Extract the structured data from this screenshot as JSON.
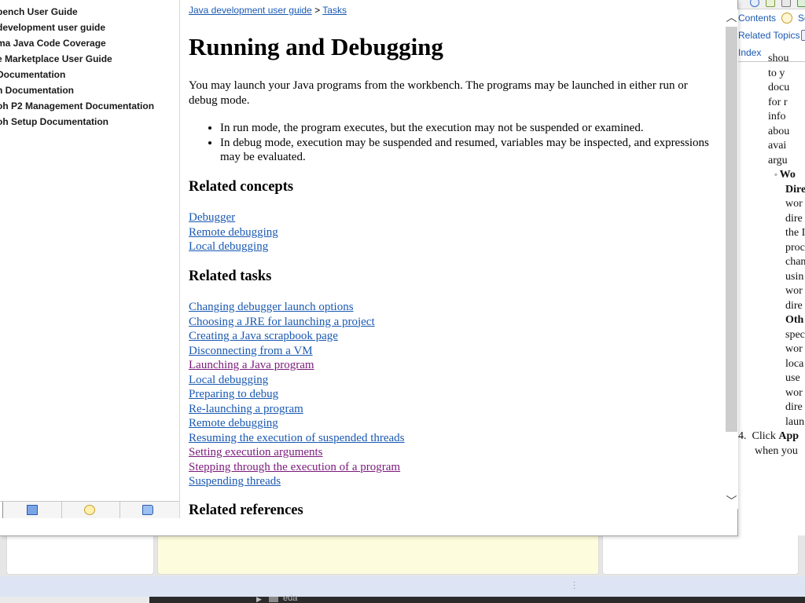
{
  "toc": {
    "items": [
      "bench User Guide",
      "development user guide",
      "ma Java Code Coverage",
      "e Marketplace User Guide",
      "Documentation",
      "n Documentation",
      "oh P2 Management Documentation",
      "oh Setup Documentation"
    ],
    "tab_icons": [
      "contents-tab",
      "bookmarks-icon",
      "search-icon",
      "book-icon"
    ]
  },
  "content": {
    "breadcrumb": {
      "parent": "Java development user guide",
      "separator": ">",
      "current": "Tasks"
    },
    "title": "Running and Debugging",
    "intro": "You may launch your Java programs from the workbench.  The programs may be launched in either run or debug mode.",
    "modes": [
      "In run mode, the program executes, but the execution may not be suspended or examined.",
      "In debug mode, execution may be suspended and resumed, variables may be inspected, and expressions may be evaluated."
    ],
    "related_concepts": {
      "heading": "Related concepts",
      "links": [
        "Debugger",
        "Remote debugging",
        "Local debugging"
      ]
    },
    "related_tasks": {
      "heading": "Related tasks",
      "links": [
        {
          "label": "Changing debugger launch options",
          "visited": false
        },
        {
          "label": "Choosing a JRE for launching a project",
          "visited": false
        },
        {
          "label": "Creating a Java scrapbook page",
          "visited": false
        },
        {
          "label": "Disconnecting from a VM",
          "visited": false
        },
        {
          "label": "Launching a Java program",
          "visited": true
        },
        {
          "label": "Local debugging",
          "visited": false
        },
        {
          "label": "Preparing to debug",
          "visited": false
        },
        {
          "label": "Re-launching a program",
          "visited": false
        },
        {
          "label": "Remote debugging",
          "visited": false
        },
        {
          "label": "Resuming the execution of suspended threads",
          "visited": false
        },
        {
          "label": "Setting execution arguments",
          "visited": true
        },
        {
          "label": "Stepping through the execution of a program",
          "visited": true
        },
        {
          "label": "Suspending threads",
          "visited": false
        }
      ]
    },
    "related_references": {
      "heading": "Related references"
    }
  },
  "background_window": {
    "tabs": {
      "contents": "Contents",
      "search": "Se",
      "related": "Related Topics",
      "index": "Index"
    },
    "text_lines": [
      {
        "text": "shou",
        "bold": false
      },
      {
        "text": "to y",
        "bold": false
      },
      {
        "text": "docu",
        "bold": false
      },
      {
        "text": "for r",
        "bold": false
      },
      {
        "text": "info",
        "bold": false
      },
      {
        "text": "abou",
        "bold": false
      },
      {
        "text": "avai",
        "bold": false
      },
      {
        "text": "argu",
        "bold": false
      },
      {
        "text": "Wo",
        "bold": true,
        "bullet": "◦"
      },
      {
        "text": "Dire",
        "bold": true
      },
      {
        "text": "wor",
        "bold": false
      },
      {
        "text": "dire",
        "bold": false
      },
      {
        "text": "the I",
        "bold": false
      },
      {
        "text": "proc",
        "bold": false
      },
      {
        "text": "chan",
        "bold": false
      },
      {
        "text": "usin",
        "bold": false
      },
      {
        "text": "wor",
        "bold": false
      },
      {
        "text": "dire",
        "bold": false
      },
      {
        "text": "Oth",
        "bold": true
      },
      {
        "text": "spec",
        "bold": false
      },
      {
        "text": "wor",
        "bold": false
      },
      {
        "text": "loca",
        "bold": false
      },
      {
        "text": "use",
        "bold": false
      },
      {
        "text": "wor",
        "bold": false
      },
      {
        "text": "dire",
        "bold": false
      },
      {
        "text": "laun",
        "bold": false
      }
    ],
    "step4_prefix": "4.  Click ",
    "step4_bold": "App",
    "step4_line2": "when you"
  },
  "taskbar": {
    "label": "eda"
  },
  "colors": {
    "link": "#1a59b2",
    "visited_link": "#7a1a7a",
    "status_bar": "#dde4f3",
    "editor_highlight": "#fdfcdc"
  }
}
